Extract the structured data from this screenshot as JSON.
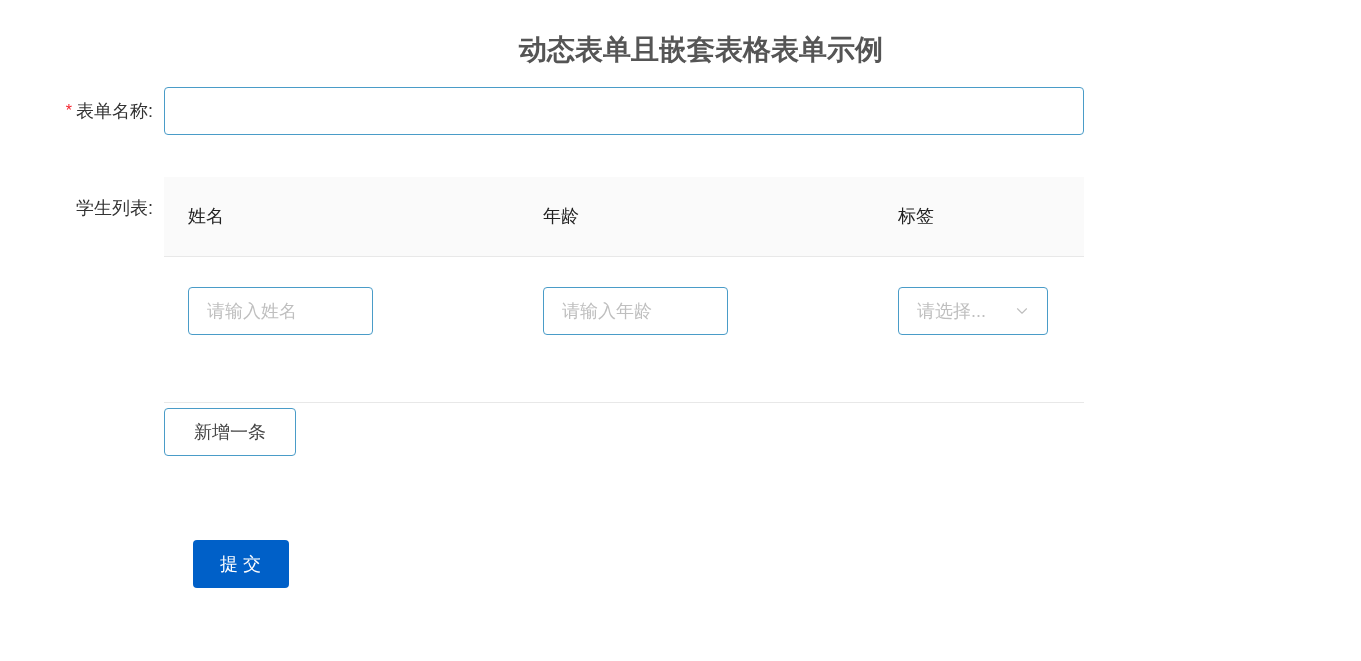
{
  "title": "动态表单且嵌套表格表单示例",
  "form_name": {
    "label": "表单名称:",
    "required": true,
    "required_mark": "*"
  },
  "student_list": {
    "label": "学生列表:",
    "columns": [
      "姓名",
      "年龄",
      "标签"
    ],
    "rows": [
      {
        "cells": [
          {
            "kind": "input",
            "placeholder": "请输入姓名"
          },
          {
            "kind": "input",
            "placeholder": "请输入年龄"
          },
          {
            "kind": "select",
            "placeholder": "请选择..."
          }
        ]
      }
    ],
    "add_button": "新增一条"
  },
  "submit_button": "提 交"
}
